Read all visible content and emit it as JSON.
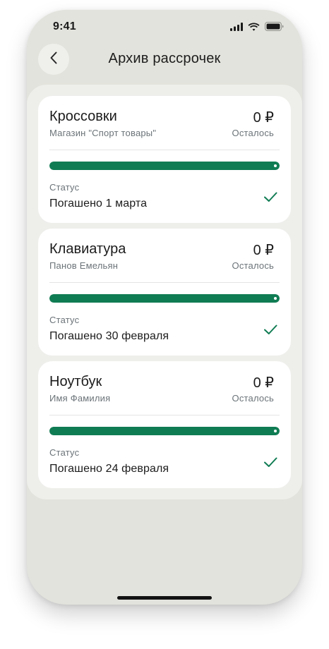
{
  "status_bar": {
    "time": "9:41",
    "icons": [
      "signal-icon",
      "wifi-icon",
      "battery-icon"
    ]
  },
  "header": {
    "back_icon": "chevron-left-icon",
    "title": "Архив рассрочек"
  },
  "colors": {
    "accent": "#107c54",
    "background": "#e3e3dd",
    "panel": "#eeeeeb",
    "card": "#ffffff"
  },
  "installments": [
    {
      "name": "Кроссовки",
      "seller": "Магазин \"Спорт товары\"",
      "amount": "0 ₽",
      "remaining_label": "Осталось",
      "progress": 1.0,
      "status_label": "Статус",
      "status_value": "Погашено 1 марта",
      "status_icon": "check-icon"
    },
    {
      "name": "Клавиатура",
      "seller": "Панов Емельян",
      "amount": "0 ₽",
      "remaining_label": "Осталось",
      "progress": 1.0,
      "status_label": "Статус",
      "status_value": "Погашено 30 февраля",
      "status_icon": "check-icon"
    },
    {
      "name": "Ноутбук",
      "seller": "Имя Фамилия",
      "amount": "0 ₽",
      "remaining_label": "Осталось",
      "progress": 1.0,
      "status_label": "Статус",
      "status_value": "Погашено 24 февраля",
      "status_icon": "check-icon"
    }
  ]
}
